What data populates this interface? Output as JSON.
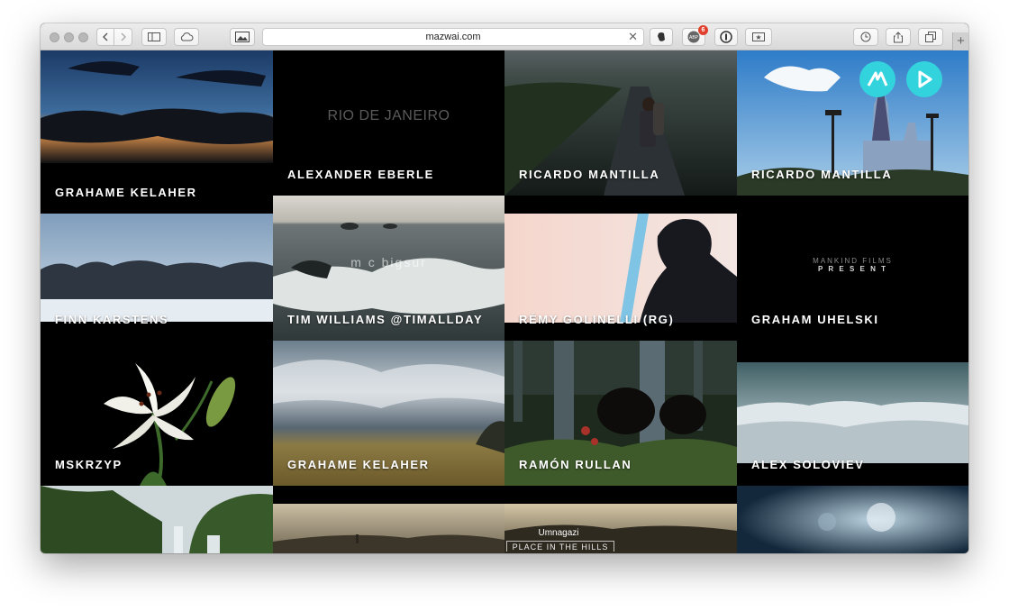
{
  "browser": {
    "url": "mazwai.com",
    "adblock_count": "6",
    "new_tab": "+"
  },
  "tiles": [
    {
      "title": "GRAHAME KELAHER"
    },
    {
      "title": "ALEXANDER EBERLE",
      "overlay": "RIO DE JANEIRO"
    },
    {
      "title": "RICARDO MANTILLA"
    },
    {
      "title": "RICARDO MANTILLA"
    },
    {
      "title": "FINN KARSTENS"
    },
    {
      "title": "TIM WILLIAMS @TIMALLDAY",
      "overlay": "m c bigsur"
    },
    {
      "title": "RÉMY GOLINELLI (RG)"
    },
    {
      "title": "GRAHAM UHELSKI",
      "overlay_line1": "MANKIND FILMS",
      "overlay_line2": "P R E S E N T"
    },
    {
      "title": "MSKRZYP"
    },
    {
      "title": "GRAHAME KELAHER"
    },
    {
      "title": "RAMÓN RULLAN"
    },
    {
      "title": "ALEX SOLOVIEV"
    },
    {
      "title": ""
    },
    {
      "title": ""
    },
    {
      "title": "",
      "overlay_line1": "Umnagazi",
      "overlay_line2": "PLACE IN THE HILLS"
    },
    {
      "title": ""
    }
  ],
  "colors": {
    "accent": "#33d3dd",
    "badge": "#e0402c"
  },
  "icons": {
    "logo": "mazwai-logo-icon",
    "play": "play-icon"
  }
}
